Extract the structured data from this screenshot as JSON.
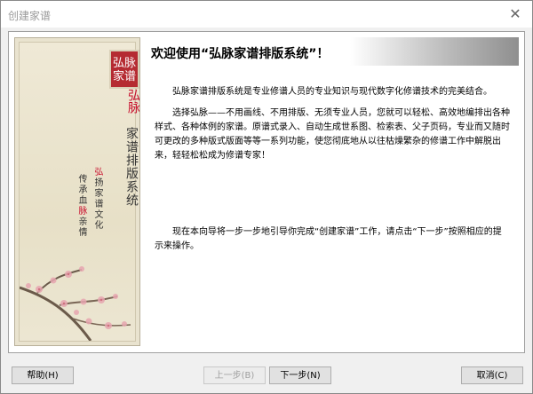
{
  "window": {
    "title": "创建家谱",
    "close_glyph": "✕"
  },
  "panel": {
    "seal_text": "弘脉家谱",
    "title_red": "弘脉",
    "title_main": "家谱排版系统",
    "slogan_right_red": "弘",
    "slogan_right_rest": "扬家谱文化",
    "slogan_left_a": "传承血",
    "slogan_left_red": "脉",
    "slogan_left_b": "亲情"
  },
  "header": {
    "text": "欢迎使用“弘脉家谱排版系统”！"
  },
  "body": {
    "p1": "弘脉家谱排版系统是专业修谱人员的专业知识与现代数字化修谱技术的完美结合。",
    "p2": "选择弘脉——不用画线、不用排版、无须专业人员，您就可以轻松、高效地编排出各种样式、各种体例的家谱。原谱式录入、自动生成世系图、检索表、父子页码，专业而又随时可更改的多种版式版面等等一系列功能，使您彻底地从以往枯燥繁杂的修谱工作中解脱出来，轻轻松松成为修谱专家！",
    "p3": "现在本向导将一步一步地引导你完成“创建家谱”工作，请点击“下一步”按照相应的提示来操作。"
  },
  "buttons": {
    "help": "帮助(H)",
    "prev": "上一步(B)",
    "next": "下一步(N)",
    "cancel": "取消(C)"
  },
  "colors": {
    "seal_red": "#b52b32",
    "accent_red": "#c8102e"
  }
}
